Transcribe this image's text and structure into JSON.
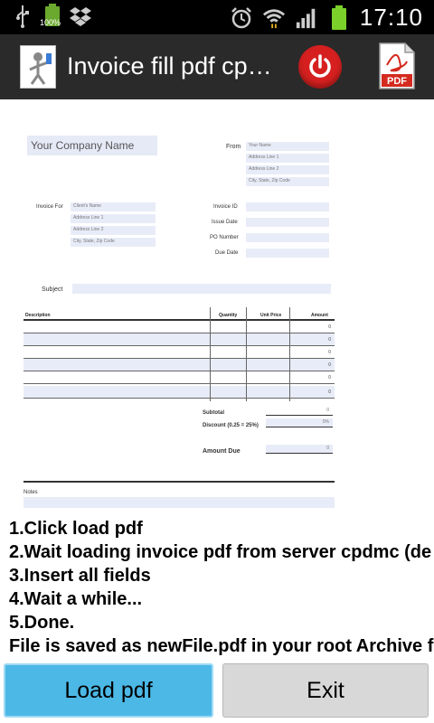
{
  "status_bar": {
    "icons_left": [
      "usb-icon",
      "battery-small-icon",
      "dropbox-icon"
    ],
    "battery_small_label": "100%",
    "icons_right": [
      "alarm-icon",
      "wifi-icon",
      "signal-icon",
      "battery-icon"
    ],
    "time": "17:10"
  },
  "action_bar": {
    "title": "Invoice fill pdf cp…",
    "power_icon": "power-icon",
    "pdf_icon": "pdf-icon",
    "pdf_label": "PDF"
  },
  "invoice": {
    "company_name": "Your Company Name",
    "from_label": "From",
    "from_fields": [
      "Your Name",
      "Address Line 1",
      "Address Line 2",
      "City, State, Zip Code"
    ],
    "invoice_for_label": "Invoice For",
    "client_fields": [
      "Client's Name",
      "Address Line 1",
      "Address Line 2",
      "City, State, Zip Code"
    ],
    "invoice_id_label": "Invoice ID",
    "issue_date_label": "Issue Date",
    "po_number_label": "PO Number",
    "due_date_label": "Due Date",
    "subject_label": "Subject",
    "columns": [
      "Description",
      "Quantity",
      "Unit Price",
      "Amount"
    ],
    "row_amounts": [
      "0",
      "0",
      "0",
      "0",
      "0",
      "0"
    ],
    "subtotal_label": "Subtotal",
    "subtotal_value": "0",
    "discount_label": "Discount (0.25 = 25%)",
    "discount_value": "0%",
    "amount_due_label": "Amount Due",
    "amount_due_value": "0",
    "notes_label": "Notes"
  },
  "instructions": [
    "1.Click load pdf",
    "2.Wait loading invoice pdf from server cpdmc (de",
    "3.Insert all fields",
    "4.Wait a while...",
    "5.Done.",
    "File is saved as newFile.pdf in your root Archive f"
  ],
  "buttons": {
    "load": "Load pdf",
    "exit": "Exit"
  },
  "colors": {
    "accent": "#4cb8e6",
    "field_bg": "#e8ecf8",
    "power_red": "#d62020"
  }
}
